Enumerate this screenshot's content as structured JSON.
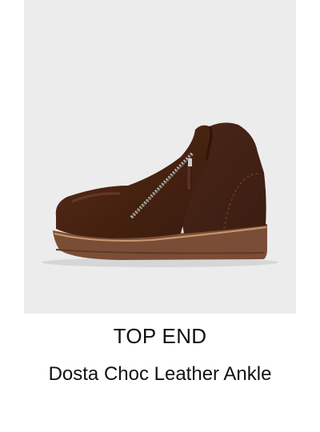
{
  "product": {
    "brand": "TOP END",
    "name": "Dosta Choc Leather Ankle",
    "image": {
      "icon": "ankle-boot-photo",
      "background_color": "#ececec",
      "boot_color": "#4a2418",
      "sole_color": "#7a4e36"
    }
  }
}
